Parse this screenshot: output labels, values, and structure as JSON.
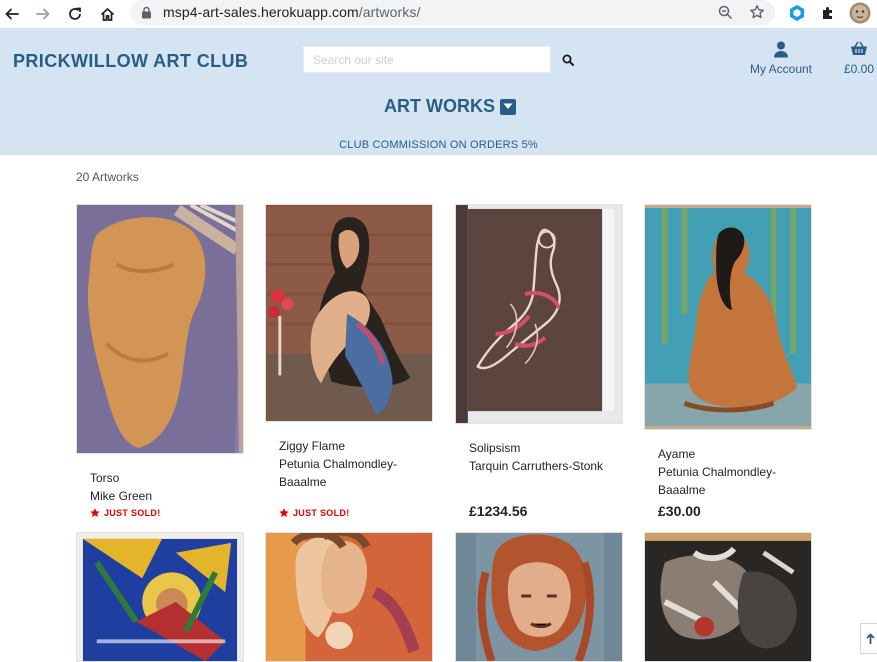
{
  "browser": {
    "url_host": "msp4-art-sales.herokuapp.com",
    "url_path": "/artworks/"
  },
  "header": {
    "brand": "PRICKWILLOW ART CLUB",
    "search_placeholder": "Search our site",
    "account_label": "My Account",
    "basket_total": "£0.00",
    "menu_title": "ART WORKS",
    "commission": "CLUB COMMISSION ON ORDERS 5%"
  },
  "main": {
    "count": "20 Artworks",
    "sold_label": "JUST SOLD!",
    "artworks": [
      {
        "title": "Torso",
        "artist": "Mike Green",
        "price": "",
        "sold": true
      },
      {
        "title": "Ziggy Flame",
        "artist": "Petunia Chalmondley-Baaalme",
        "price": "",
        "sold": true
      },
      {
        "title": "Solipsism",
        "artist": "Tarquin Carruthers-Stonk",
        "price": "£1234.56",
        "sold": false
      },
      {
        "title": "Ayame",
        "artist": "Petunia Chalmondley-Baaalme",
        "price": "£30.00",
        "sold": false
      }
    ]
  },
  "colors": {
    "header_bg": "#d5e4f2",
    "brand": "#2a5d85",
    "sold": "#e40000"
  }
}
